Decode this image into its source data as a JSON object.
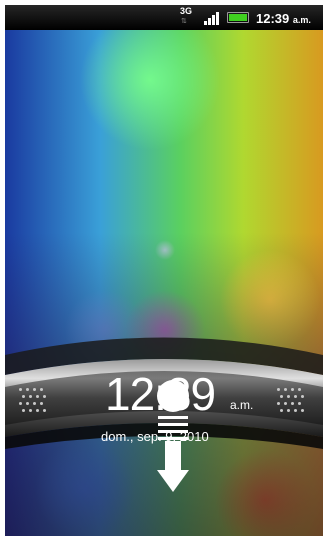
{
  "status_bar": {
    "network_type": "3G",
    "network_arrows": "⇅",
    "time": "12:39",
    "ampm": "a.m."
  },
  "lock_screen": {
    "time": "12:39",
    "ampm": "a.m.",
    "date": "dom., sep. 9, 2010"
  },
  "icons": {
    "signal": "signal-strength-icon",
    "battery": "battery-icon",
    "unlock_handle": "unlock-handle-icon",
    "down_arrow": "down-arrow-icon"
  },
  "colors": {
    "battery_fill": "#40d020",
    "status_bar": "#000000",
    "lock_text": "#ffffff"
  }
}
